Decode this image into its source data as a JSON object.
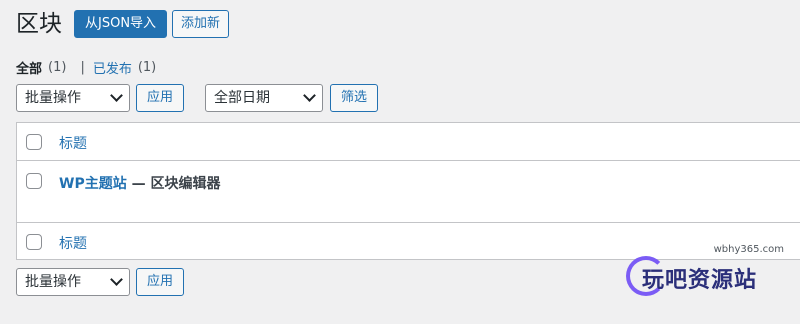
{
  "header": {
    "title": "区块",
    "import_button": "从JSON导入",
    "add_new_button": "添加新"
  },
  "views": {
    "all_label": "全部",
    "all_count": "(1)",
    "separator": "|",
    "published_label": "已发布",
    "published_count": "(1)"
  },
  "top_actions": {
    "bulk_select_value": "批量操作",
    "apply_button": "应用",
    "date_select_value": "全部日期",
    "filter_button": "筛选"
  },
  "table": {
    "column_title": "标题",
    "rows": [
      {
        "title_link": "WP主题站",
        "title_rest": " — 区块编辑器"
      }
    ],
    "footer_column_title": "标题"
  },
  "bottom_actions": {
    "bulk_select_value": "批量操作",
    "apply_button": "应用"
  },
  "watermark": {
    "url": "wbhy365.com",
    "brand": "玩吧资源站"
  },
  "colors": {
    "background": "#f0f0f1",
    "accent": "#2271b1",
    "border": "#c3c4c7"
  }
}
